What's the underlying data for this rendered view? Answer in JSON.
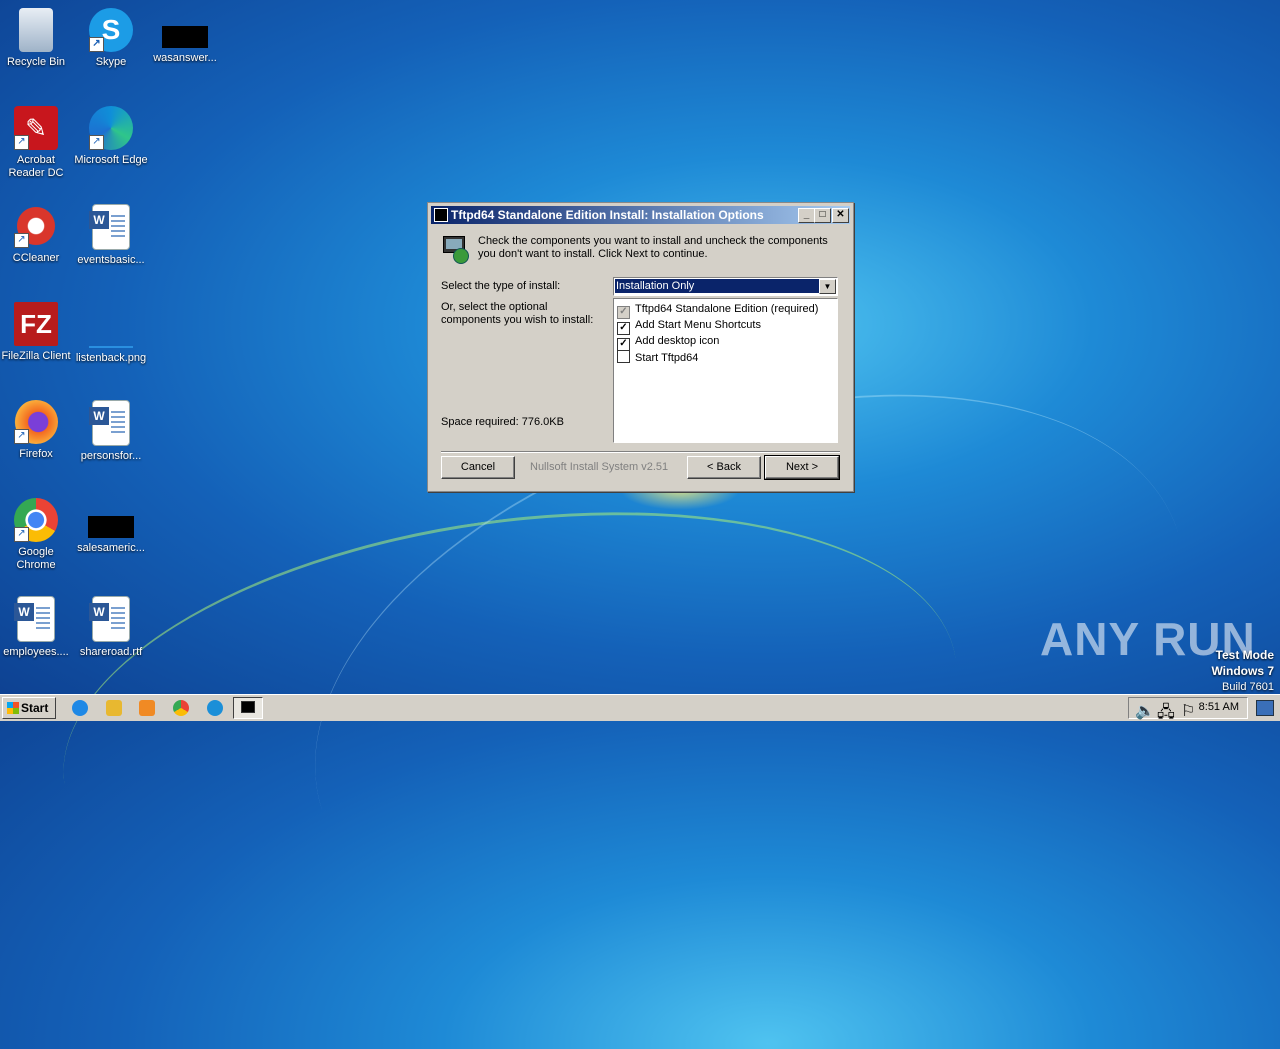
{
  "desktop": {
    "icons": [
      {
        "label": "Recycle Bin"
      },
      {
        "label": "Skype"
      },
      {
        "label": "wasanswer..."
      },
      {
        "label": "Acrobat Reader DC"
      },
      {
        "label": "Microsoft Edge"
      },
      {
        "label": "CCleaner"
      },
      {
        "label": "eventsbasic..."
      },
      {
        "label": "FileZilla Client"
      },
      {
        "label": "listenback.png"
      },
      {
        "label": "Firefox"
      },
      {
        "label": "personsfor..."
      },
      {
        "label": "Google Chrome"
      },
      {
        "label": "salesameric..."
      },
      {
        "label": "employees...."
      },
      {
        "label": "shareroad.rtf"
      }
    ]
  },
  "dialog": {
    "title": "Tftpd64 Standalone Edition Install: Installation Options",
    "header_text": "Check the components you want to install and uncheck the components you don't want to install. Click Next to continue.",
    "install_type_label": "Select the type of install:",
    "install_type_value": "Installation Only",
    "optional_label": "Or, select the optional components you wish to install:",
    "space_required": "Space required: 776.0KB",
    "components": [
      {
        "label": "Tftpd64 Standalone Edition (required)",
        "checked": true,
        "disabled": true
      },
      {
        "label": "Add Start Menu Shortcuts",
        "checked": true,
        "disabled": false
      },
      {
        "label": "Add desktop icon",
        "checked": true,
        "disabled": false
      },
      {
        "label": "Start Tftpd64",
        "checked": false,
        "disabled": false
      }
    ],
    "cancel_label": "Cancel",
    "branding": "Nullsoft Install System v2.51",
    "back_label": "< Back",
    "next_label": "Next >"
  },
  "watermark": {
    "text": "ANY RUN",
    "test_mode": "Test Mode",
    "os": "Windows 7",
    "build": "Build 7601"
  },
  "taskbar": {
    "start_label": "Start",
    "clock": "8:51 AM"
  },
  "colors": {
    "title_active": "#0a246a",
    "dialog_face": "#d4d0c8",
    "selection": "#0a246a"
  }
}
